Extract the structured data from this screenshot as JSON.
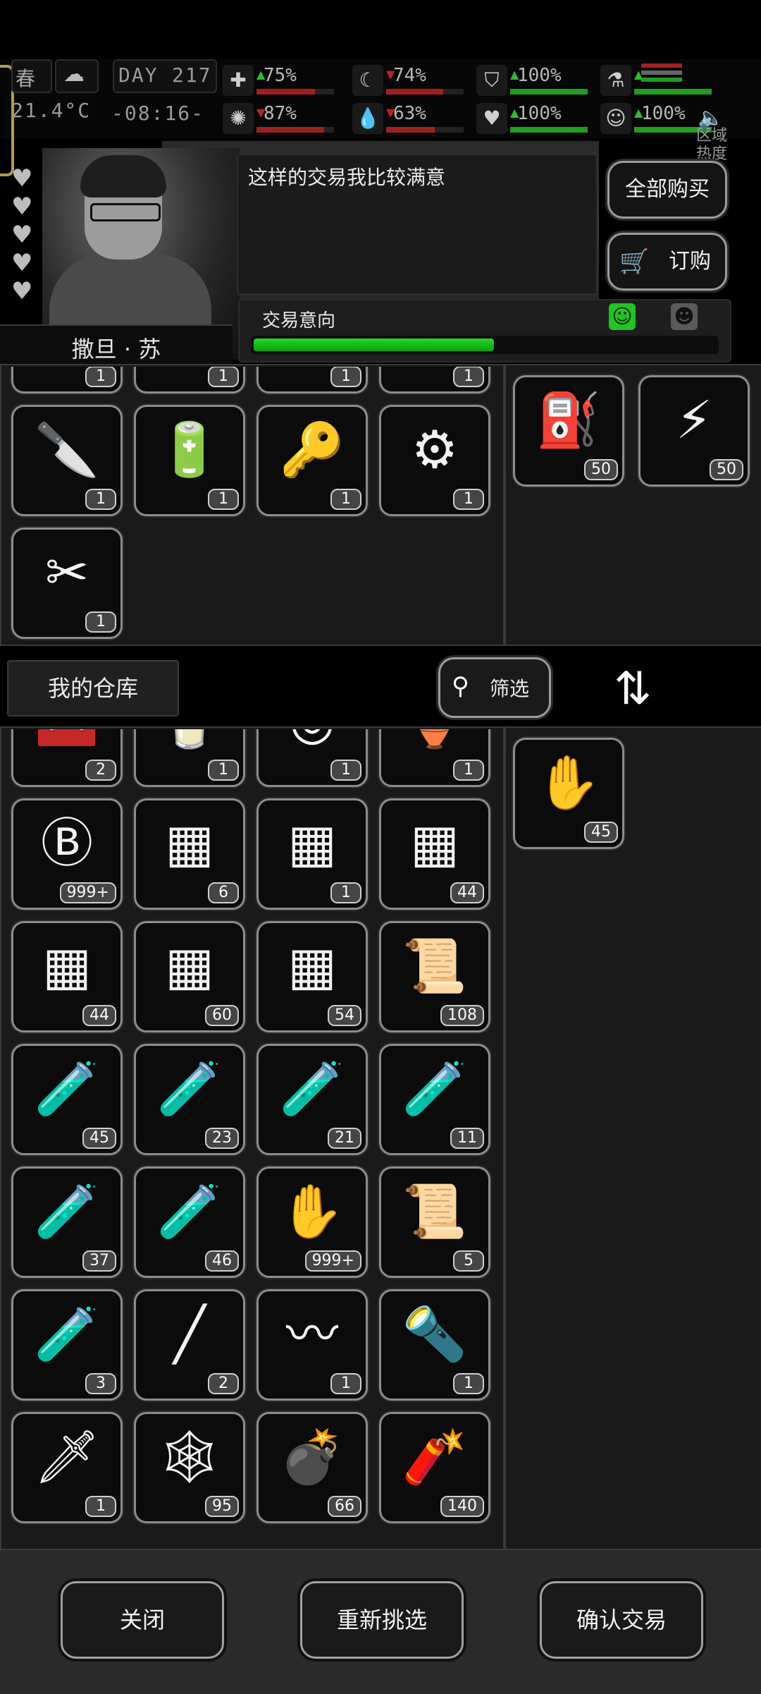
{
  "status": {
    "season": "春",
    "day_label": "DAY",
    "day_value": "217",
    "temperature": "21.4°C",
    "time": "-08:16-",
    "zone_label": "区域热度",
    "stats_top": [
      {
        "icon": "medkit-icon",
        "glyph": "✚",
        "arrow": "▲",
        "arrow_color": "#2bbf2b",
        "value": "75%",
        "fill": 0.75,
        "color": "#a02020"
      },
      {
        "icon": "stomach-icon",
        "glyph": "☾",
        "arrow": "▼",
        "arrow_color": "#c02020",
        "value": "74%",
        "fill": 0.74,
        "color": "#a02020"
      },
      {
        "icon": "shield-icon",
        "glyph": "⛉",
        "arrow": "▲",
        "arrow_color": "#2bbf2b",
        "value": "100%",
        "fill": 1.0,
        "color": "#1f9e1f"
      },
      {
        "icon": "flask-icon",
        "glyph": "⚗",
        "arrow": "▲",
        "arrow_color": "#2bbf2b",
        "value": "",
        "fill": 1.0,
        "color": "#1f9e1f"
      }
    ],
    "stats_bottom": [
      {
        "icon": "brain-icon",
        "glyph": "✺",
        "arrow": "▼",
        "arrow_color": "#c02020",
        "value": "87%",
        "fill": 0.87,
        "color": "#a02020"
      },
      {
        "icon": "water-drop-icon",
        "glyph": "💧",
        "arrow": "▼",
        "arrow_color": "#c02020",
        "value": "63%",
        "fill": 0.63,
        "color": "#a02020"
      },
      {
        "icon": "heart-icon",
        "glyph": "♥",
        "arrow": "▲",
        "arrow_color": "#2bbf2b",
        "value": "100%",
        "fill": 1.0,
        "color": "#1f9e1f"
      },
      {
        "icon": "mood-icon",
        "glyph": "☺",
        "arrow": "▲",
        "arrow_color": "#2bbf2b",
        "value": "100%",
        "fill": 1.0,
        "color": "#1f9e1f"
      }
    ]
  },
  "trader": {
    "name": "撒旦 · 苏",
    "dialog": "这样的交易我比较满意",
    "hearts": 5,
    "buttons": {
      "buy_all": "全部购买",
      "order": "订购"
    },
    "intent_label": "交易意向",
    "intent_level": 0.52
  },
  "trader_inventory": {
    "items": [
      {
        "name": "blueprint-icon",
        "glyph": "▭",
        "count": "1"
      },
      {
        "name": "document-icon",
        "glyph": "▤",
        "count": "1"
      },
      {
        "name": "document-icon",
        "glyph": "▤",
        "count": "1"
      },
      {
        "name": "document-icon",
        "glyph": "▤",
        "count": "1"
      },
      {
        "name": "knife-blueprint-icon",
        "glyph": "🔪",
        "count": "1"
      },
      {
        "name": "battery-blueprint-icon",
        "glyph": "🔋",
        "count": "1"
      },
      {
        "name": "car-key-icon",
        "glyph": "🔑",
        "count": "1"
      },
      {
        "name": "wheel-blueprint-icon",
        "glyph": "⚙",
        "count": "1"
      },
      {
        "name": "tool-blueprint-icon",
        "glyph": "✂",
        "count": "1"
      }
    ],
    "selected": [
      {
        "name": "fuel-can-icon",
        "glyph": "⛽",
        "count": "50"
      },
      {
        "name": "battery-icon",
        "glyph": "⚡",
        "count": "50"
      }
    ]
  },
  "warehouse": {
    "tab_label": "我的仓库",
    "filter_label": "筛选",
    "items": [
      {
        "name": "toolbox-icon",
        "glyph": "🧰",
        "count": "2"
      },
      {
        "name": "juice-glass-icon",
        "glyph": "🥛",
        "count": "1"
      },
      {
        "name": "tape-roll-icon",
        "glyph": "◎",
        "count": "1"
      },
      {
        "name": "herbal-jug-icon",
        "glyph": "🏺",
        "count": "1"
      },
      {
        "name": "bitcoin-coin-icon",
        "glyph": "Ⓑ",
        "count": "999+"
      },
      {
        "name": "supply-crate-v-icon",
        "glyph": "▦",
        "count": "6"
      },
      {
        "name": "supply-crate-special-icon",
        "glyph": "▦",
        "count": "1"
      },
      {
        "name": "supply-crate-iv-icon",
        "glyph": "▦",
        "count": "44"
      },
      {
        "name": "supply-crate-iii-icon",
        "glyph": "▦",
        "count": "44"
      },
      {
        "name": "supply-crate-ii-icon",
        "glyph": "▦",
        "count": "60"
      },
      {
        "name": "supply-crate-i-icon",
        "glyph": "▦",
        "count": "54"
      },
      {
        "name": "cloth-roll-icon",
        "glyph": "📜",
        "count": "108"
      },
      {
        "name": "test-tube-iv-icon",
        "glyph": "🧪",
        "count": "45"
      },
      {
        "name": "test-tube-i-icon",
        "glyph": "🧪",
        "count": "23"
      },
      {
        "name": "test-tube-iii-icon",
        "glyph": "🧪",
        "count": "21"
      },
      {
        "name": "test-tube-v-icon",
        "glyph": "🧪",
        "count": "11"
      },
      {
        "name": "test-tube-vi-icon",
        "glyph": "🧪",
        "count": "37"
      },
      {
        "name": "test-tube-ii-icon",
        "glyph": "🧪",
        "count": "46"
      },
      {
        "name": "zombie-card-icon",
        "glyph": "✋",
        "count": "999+"
      },
      {
        "name": "bandage-roll-icon",
        "glyph": "📜",
        "count": "5"
      },
      {
        "name": "test-tube-vii-icon",
        "glyph": "🧪",
        "count": "3"
      },
      {
        "name": "pipe-icon",
        "glyph": "╱",
        "count": "2"
      },
      {
        "name": "wire-cables-icon",
        "glyph": "〰",
        "count": "1"
      },
      {
        "name": "flashlight-icon",
        "glyph": "🔦",
        "count": "1"
      },
      {
        "name": "blade-part-icon",
        "glyph": "🗡",
        "count": "1"
      },
      {
        "name": "net-trap-icon",
        "glyph": "🕸",
        "count": "95"
      },
      {
        "name": "grenade-icon",
        "glyph": "💣",
        "count": "66"
      },
      {
        "name": "frag-grenade-icon",
        "glyph": "🧨",
        "count": "140"
      }
    ],
    "selected": [
      {
        "name": "zombie-card-icon",
        "glyph": "✋",
        "count": "45"
      }
    ]
  },
  "footer": {
    "close": "关闭",
    "reselect": "重新挑选",
    "confirm": "确认交易"
  }
}
